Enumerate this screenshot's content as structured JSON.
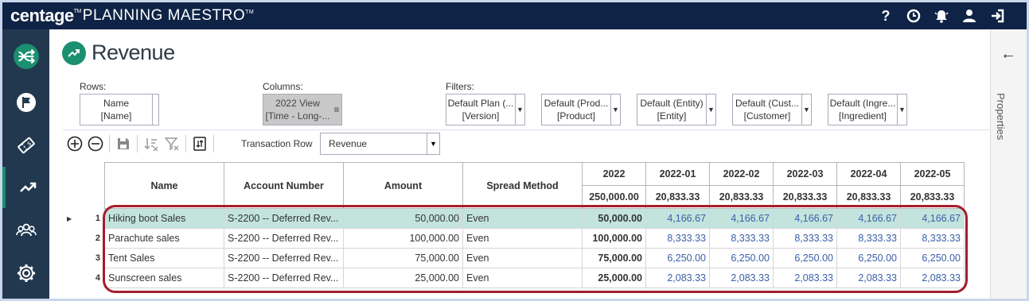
{
  "header": {
    "brand": "centage",
    "brand_tm": "TM",
    "product": "PLANNING MAESTRO",
    "product_tm": "TM",
    "icons": [
      "help-icon",
      "clock-icon",
      "alert-icon",
      "user-icon",
      "logout-icon"
    ]
  },
  "nav": {
    "items": [
      "logo-icon",
      "flag-icon",
      "ticket-icon",
      "trend-icon",
      "people-icon",
      "gear-icon"
    ],
    "active": "trend-icon"
  },
  "page": {
    "title": "Revenue"
  },
  "dims": {
    "rows_label": "Rows:",
    "columns_label": "Columns:",
    "filters_label": "Filters:",
    "rows": {
      "line1": "Name",
      "line2": "[Name]"
    },
    "columns": {
      "line1": "2022 View",
      "line2": "[Time - Long-..."
    },
    "filters": [
      {
        "line1": "Default Plan (...",
        "line2": "[Version]"
      },
      {
        "line1": "Default (Prod...",
        "line2": "[Product]"
      },
      {
        "line1": "Default (Entity)",
        "line2": "[Entity]"
      },
      {
        "line1": "Default (Cust...",
        "line2": "[Customer]"
      },
      {
        "line1": "Default (Ingre...",
        "line2": "[Ingredient]"
      }
    ]
  },
  "toolbar": {
    "transaction_row_label": "Transaction Row",
    "transaction_row_value": "Revenue"
  },
  "grid": {
    "headers": {
      "name": "Name",
      "account": "Account Number",
      "amount": "Amount",
      "spread": "Spread Method",
      "periods": [
        "2022",
        "2022-01",
        "2022-02",
        "2022-03",
        "2022-04",
        "2022-05"
      ],
      "totals": [
        "250,000.00",
        "20,833.33",
        "20,833.33",
        "20,833.33",
        "20,833.33",
        "20,833.33"
      ]
    },
    "rows": [
      {
        "num": "1",
        "name": "Hiking boot Sales",
        "account": "S-2200 -- Deferred Rev...",
        "amount": "50,000.00",
        "spread": "Even",
        "year": "50,000.00",
        "months": [
          "4,166.67",
          "4,166.67",
          "4,166.67",
          "4,166.67",
          "4,166.67"
        ]
      },
      {
        "num": "2",
        "name": "Parachute sales",
        "account": "S-2200 -- Deferred Rev...",
        "amount": "100,000.00",
        "spread": "Even",
        "year": "100,000.00",
        "months": [
          "8,333.33",
          "8,333.33",
          "8,333.33",
          "8,333.33",
          "8,333.33"
        ]
      },
      {
        "num": "3",
        "name": "Tent Sales",
        "account": "S-2200 -- Deferred Rev...",
        "amount": "75,000.00",
        "spread": "Even",
        "year": "75,000.00",
        "months": [
          "6,250.00",
          "6,250.00",
          "6,250.00",
          "6,250.00",
          "6,250.00"
        ]
      },
      {
        "num": "4",
        "name": "Sunscreen sales",
        "account": "S-2200 -- Deferred Rev...",
        "amount": "25,000.00",
        "spread": "Even",
        "year": "25,000.00",
        "months": [
          "2,083.33",
          "2,083.33",
          "2,083.33",
          "2,083.33",
          "2,083.33"
        ]
      }
    ]
  },
  "properties": {
    "label": "Properties"
  },
  "colors": {
    "topbar": "#0f2346",
    "nav": "#22384f",
    "accent": "#1b8f6f",
    "selected_row": "#c3e4dd",
    "highlight": "#a51d2d"
  }
}
